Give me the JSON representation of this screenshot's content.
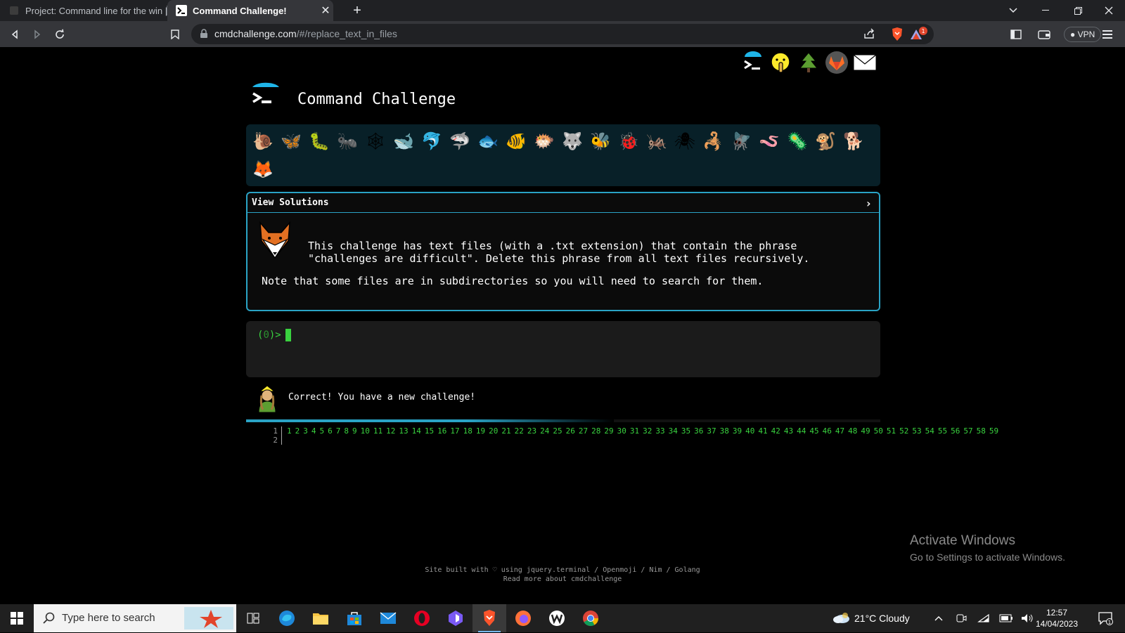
{
  "browser": {
    "tabs": [
      {
        "title": "Project: Command line for the win | Na",
        "active": false
      },
      {
        "title": "Command Challenge!",
        "active": true
      }
    ],
    "url_host": "cmdchallenge.com",
    "url_path": "/#/replace_text_in_files",
    "vpn_label": "VPN",
    "rewards_badge": "1"
  },
  "page": {
    "site_title": "Command Challenge",
    "top_icons": [
      "terminal-logo-icon",
      "shushing-face-icon",
      "tree-icon",
      "gitlab-icon",
      "mail-icon"
    ],
    "challenge_emojis": [
      "🐌",
      "🦋",
      "🐛",
      "🐜",
      "🕸",
      "🐋",
      "🐬",
      "🦈",
      "🐟",
      "🐠",
      "🐡",
      "🐺",
      "🐝",
      "🐞",
      "🦗",
      "🕷",
      "🦂",
      "🪰",
      "🪱",
      "🦠",
      "🐒",
      "🐕",
      "🦊"
    ],
    "challenge": {
      "header": "View Solutions",
      "description": "This challenge has text files (with a .txt extension) that contain the phrase \"challenges are difficult\". Delete this phrase from all text files recursively.",
      "note": "Note that some files are in subdirectories so you will need to search for them."
    },
    "terminal": {
      "prompt_open": "(",
      "prompt_code": "0",
      "prompt_close": ")>"
    },
    "result": {
      "message": "Correct! You have a new challenge!",
      "progress": 0.58
    },
    "output": {
      "line_numbers": [
        "1",
        "2"
      ],
      "numbers": [
        "1",
        "2",
        "3",
        "4",
        "5",
        "6",
        "7",
        "8",
        "9",
        "10",
        "11",
        "12",
        "13",
        "14",
        "15",
        "16",
        "17",
        "18",
        "19",
        "20",
        "21",
        "22",
        "23",
        "24",
        "25",
        "26",
        "27",
        "28",
        "29",
        "30",
        "31",
        "32",
        "33",
        "34",
        "35",
        "36",
        "37",
        "38",
        "39",
        "40",
        "41",
        "42",
        "43",
        "44",
        "45",
        "46",
        "47",
        "48",
        "49",
        "50",
        "51",
        "52",
        "53",
        "54",
        "55",
        "56",
        "57",
        "58",
        "59"
      ]
    },
    "footer": {
      "line1": "Site built with ♡ using jquery.terminal / Openmoji / Nim / Golang",
      "line2": "Read more about cmdchallenge"
    },
    "activate": {
      "title": "Activate Windows",
      "subtitle": "Go to Settings to activate Windows."
    }
  },
  "taskbar": {
    "search_placeholder": "Type here to search",
    "weather": "21°C  Cloudy",
    "time": "12:57",
    "date": "14/04/2023",
    "notification_count": "1"
  }
}
